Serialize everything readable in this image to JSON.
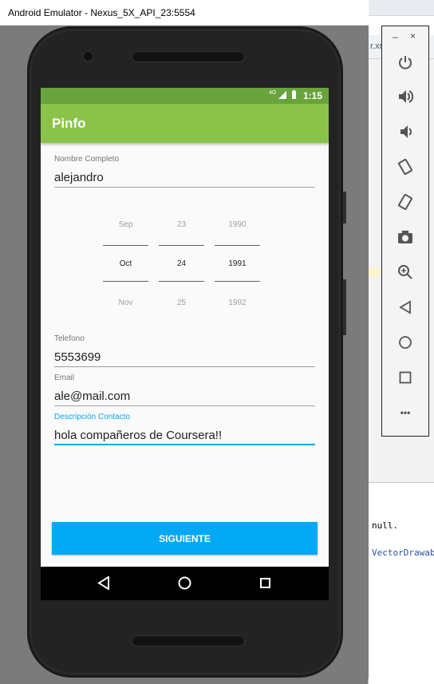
{
  "window": {
    "title": "Android Emulator - Nexus_5X_API_23:5554"
  },
  "ide": {
    "tab_fragment": "r.xm",
    "code_line_1": "null.",
    "code_line_2": "VectorDrawab"
  },
  "statusbar": {
    "network": "4G",
    "time": "1:15"
  },
  "appbar": {
    "title": "Pinfo"
  },
  "form": {
    "nombre": {
      "label": "Nombre Completo",
      "value": "alejandro"
    },
    "date_picker": {
      "month": {
        "prev": "Sep",
        "selected": "Oct",
        "next": "Nov"
      },
      "day": {
        "prev": "23",
        "selected": "24",
        "next": "25"
      },
      "year": {
        "prev": "1990",
        "selected": "1991",
        "next": "1992"
      }
    },
    "telefono": {
      "label": "Telefono",
      "value": "5553699"
    },
    "email": {
      "label": "Email",
      "value": "ale@mail.com"
    },
    "descripcion": {
      "label": "Descripción Contacto",
      "value": "hola compañeros de Coursera!!"
    },
    "submit_label": "SIGUIENTE"
  },
  "toolbar": {
    "minimize": "–",
    "close": "×",
    "more": "•••"
  },
  "colors": {
    "statusbar": "#68a33c",
    "appbar": "#8bc34a",
    "accent": "#03a9f4"
  }
}
